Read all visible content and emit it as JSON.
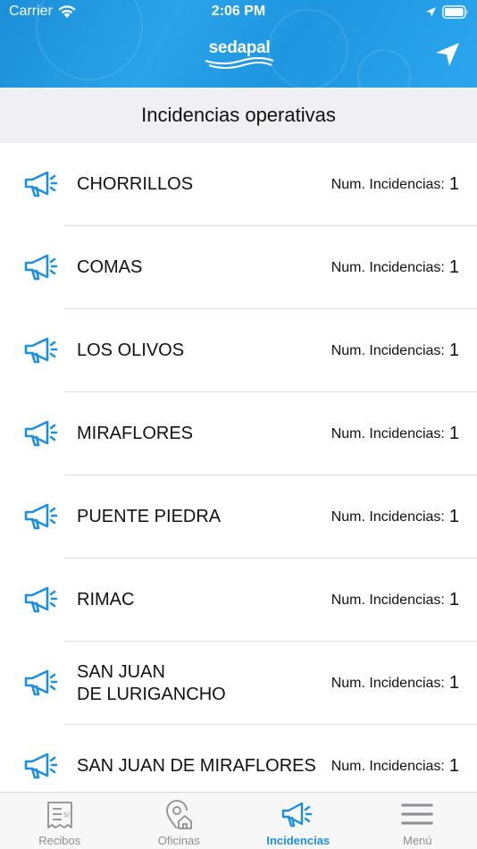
{
  "status_bar": {
    "carrier": "Carrier",
    "time": "2:06 PM"
  },
  "header": {
    "logo_text": "sedapal",
    "nav_icon": "location-arrow-icon"
  },
  "page_title": "Incidencias operativas",
  "list": {
    "count_label": "Num. Incidencias:",
    "items": [
      {
        "name": "CHORRILLOS",
        "count": "1"
      },
      {
        "name": "COMAS",
        "count": "1"
      },
      {
        "name": "LOS OLIVOS",
        "count": "1"
      },
      {
        "name": "MIRAFLORES",
        "count": "1"
      },
      {
        "name": "PUENTE PIEDRA",
        "count": "1"
      },
      {
        "name": "RIMAC",
        "count": "1"
      },
      {
        "name": "SAN JUAN\nDE LURIGANCHO",
        "count": "1"
      },
      {
        "name": "SAN JUAN DE MIRAFLORES",
        "count": "1"
      }
    ]
  },
  "tabs": [
    {
      "label": "Recibos",
      "icon": "receipt-icon"
    },
    {
      "label": "Oficinas",
      "icon": "office-location-icon"
    },
    {
      "label": "Incidencias",
      "icon": "megaphone-icon",
      "active": true
    },
    {
      "label": "Menú",
      "icon": "hamburger-menu-icon"
    }
  ],
  "colors": {
    "primary": "#1d8fe0",
    "title_bar_bg": "#efeff4",
    "inactive_tab": "#8e8e93"
  }
}
